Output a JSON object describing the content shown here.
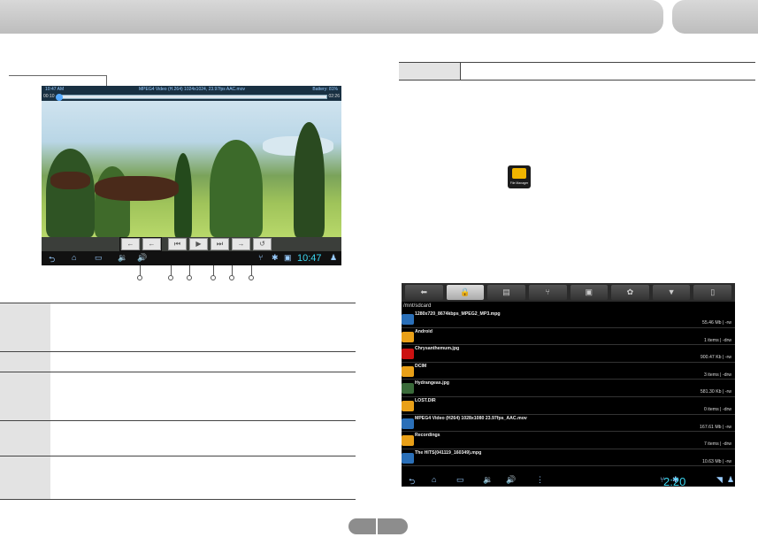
{
  "player": {
    "status_time": "10:47 AM",
    "status_title": "MPEG4 Video (H.264) 1024x1024, 23.97fps AAC.mov",
    "status_battery": "Battery: 81%",
    "elapsed": "00:10",
    "duration": "02:26",
    "progress_fraction": 0.0,
    "controls": [
      "←",
      "←",
      "⏮",
      "▶",
      "⏭",
      "→",
      "↺"
    ],
    "clock": "10:47"
  },
  "file_manager": {
    "app_label": "File Manager",
    "path": "/mnt/sdcard",
    "tabs": [
      "⬅",
      "🔒",
      "▤",
      "⑂",
      "▣",
      "✿",
      "▼",
      "▯"
    ],
    "files": [
      {
        "name": "1280x720_8674kbps_MPEG2_MP3.mpg",
        "meta": "55.46 Mb | -rw",
        "kind": "video"
      },
      {
        "name": "Android",
        "meta": "1 items | -drw",
        "kind": "folder"
      },
      {
        "name": "Chrysanthemum.jpg",
        "meta": "900.47 Kb | -rw",
        "kind": "img1"
      },
      {
        "name": "DCIM",
        "meta": "3 items | -drw",
        "kind": "folder"
      },
      {
        "name": "Hydrangeas.jpg",
        "meta": "581.30 Kb | -rw",
        "kind": "img2"
      },
      {
        "name": "LOST.DIR",
        "meta": "0 items | -drw",
        "kind": "folder"
      },
      {
        "name": "MPEG4 Video (H264) 1028x1080 23.97fps_AAC.mov",
        "meta": "167.61 Mb | -rw",
        "kind": "video"
      },
      {
        "name": "Recordings",
        "meta": "7 items | -drw",
        "kind": "folder"
      },
      {
        "name": "The HITS(041119_160349).mpg",
        "meta": "10.63 Mb | -rw",
        "kind": "video"
      }
    ],
    "clock": "2:20"
  }
}
